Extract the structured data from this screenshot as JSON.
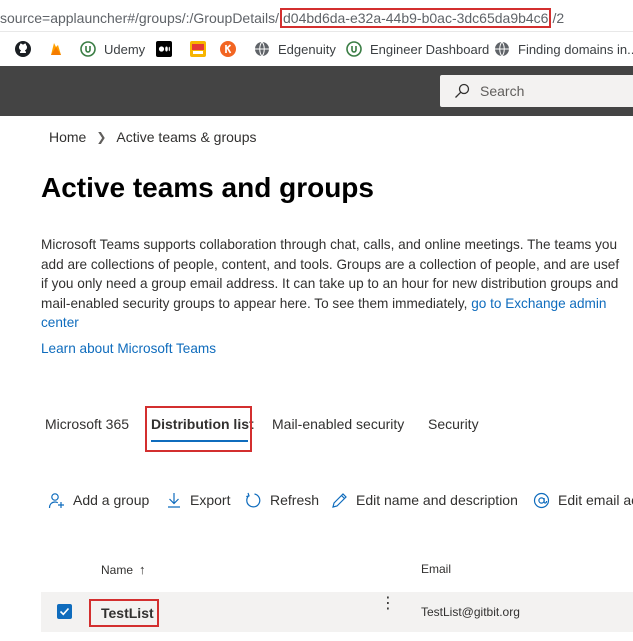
{
  "browser": {
    "url_prefix": "source=applauncher#/groups/:/GroupDetails/",
    "url_group_id": "d04bd6da-e32a-44b9-b0ac-3dc65da9b4c6",
    "url_suffix": "/2",
    "bookmarks": [
      {
        "label": "",
        "icon": "github-icon"
      },
      {
        "label": "",
        "icon": "firebase-icon"
      },
      {
        "label": "Udemy",
        "icon": "udemy-icon"
      },
      {
        "label": "",
        "icon": "medium-icon"
      },
      {
        "label": "",
        "icon": "photo-app-icon"
      },
      {
        "label": "",
        "icon": "k-icon"
      },
      {
        "label": "Edgenuity",
        "icon": "globe-icon"
      },
      {
        "label": "Engineer Dashboard",
        "icon": "udemy-icon"
      },
      {
        "label": "Finding domains in...",
        "icon": "globe-icon"
      }
    ]
  },
  "header": {
    "search_placeholder": "Search"
  },
  "breadcrumb": {
    "home": "Home",
    "current": "Active teams & groups"
  },
  "page": {
    "title": "Active teams and groups",
    "description_lines": [
      "Microsoft Teams supports collaboration through chat, calls, and online meetings. The teams you",
      "add are collections of people, content, and tools. Groups are a collection of people, and are usef",
      "if you only need a group email address. It can take up to an hour for new distribution groups and",
      "mail-enabled security groups to appear here. To see them immediately, "
    ],
    "exchange_link": "go to Exchange admin",
    "exchange_link_cont": "center",
    "learn_link": "Learn about Microsoft Teams"
  },
  "tabs": [
    {
      "label": "Microsoft 365",
      "active": false
    },
    {
      "label": "Distribution list",
      "active": true
    },
    {
      "label": "Mail-enabled security",
      "active": false
    },
    {
      "label": "Security",
      "active": false
    }
  ],
  "commands": {
    "add": "Add a group",
    "export": "Export",
    "refresh": "Refresh",
    "edit": "Edit name and description",
    "email": "Edit email ac"
  },
  "table": {
    "columns": {
      "name": "Name",
      "name_sort": "↑",
      "email": "Email"
    },
    "rows": [
      {
        "name": "TestList",
        "email": "TestList@gitbit.org",
        "selected": true
      }
    ]
  },
  "colors": {
    "accent": "#0f6cbd",
    "header_bg": "#444444",
    "highlight_box": "#d32f2f"
  }
}
